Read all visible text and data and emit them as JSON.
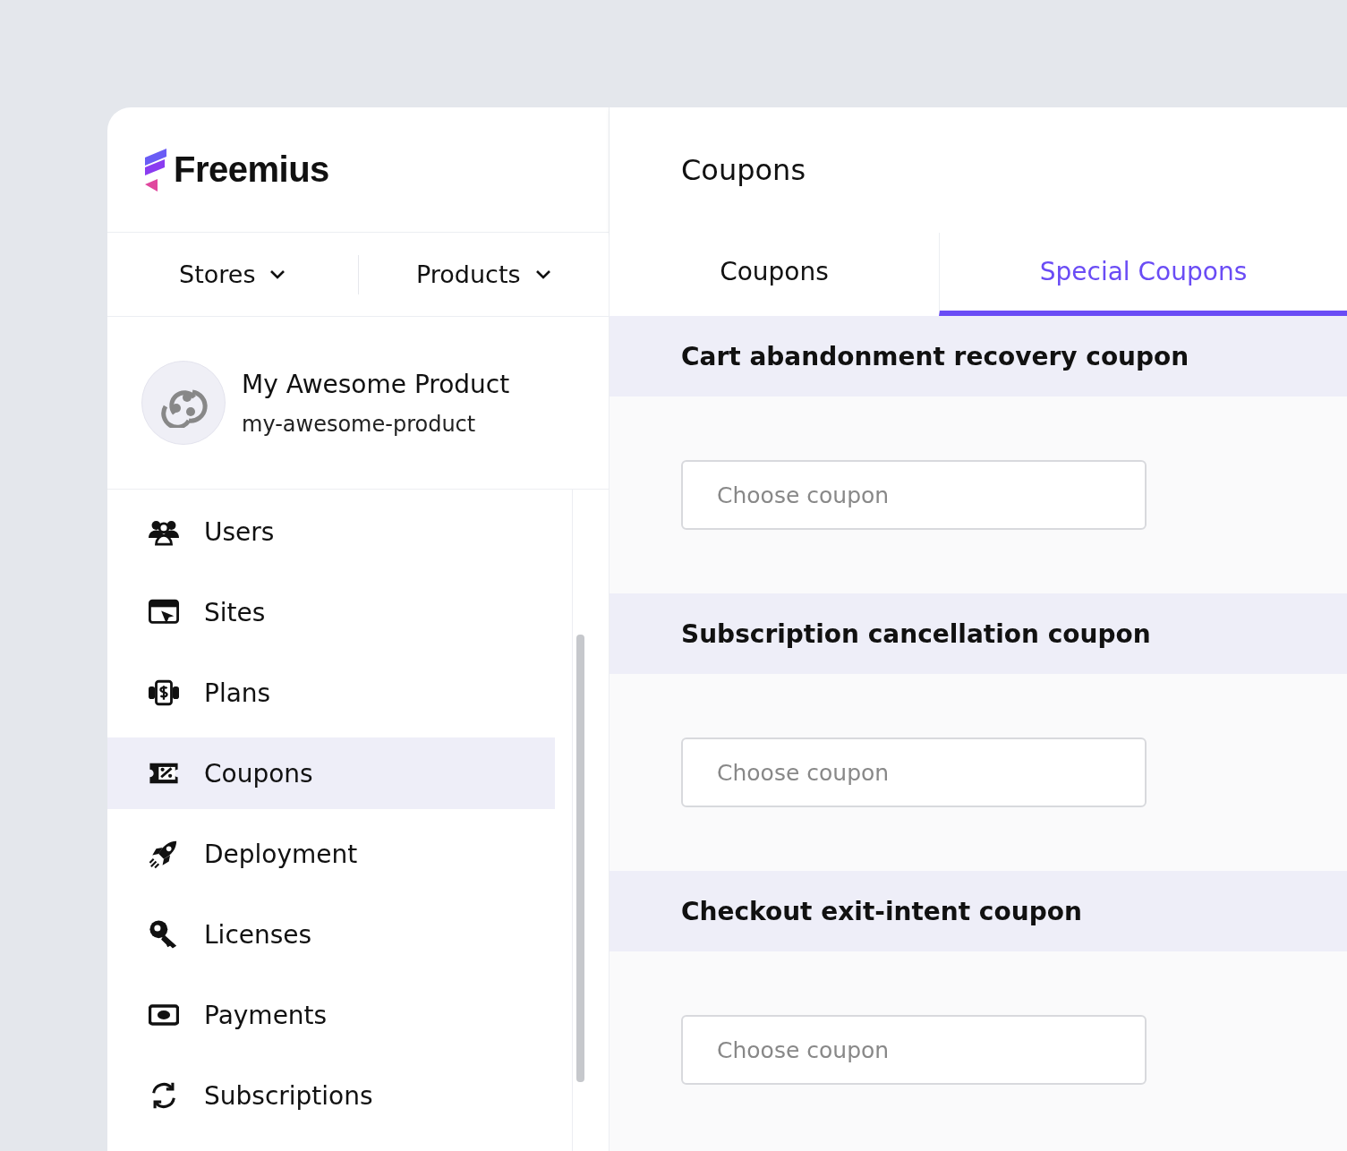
{
  "logo": {
    "text": "Freemius"
  },
  "switchers": [
    {
      "label": "Stores"
    },
    {
      "label": "Products"
    }
  ],
  "product": {
    "name": "My Awesome Product",
    "slug": "my-awesome-product"
  },
  "nav": [
    {
      "label": "Users",
      "selected": false
    },
    {
      "label": "Sites",
      "selected": false
    },
    {
      "label": "Plans",
      "selected": false
    },
    {
      "label": "Coupons",
      "selected": true
    },
    {
      "label": "Deployment",
      "selected": false
    },
    {
      "label": "Licenses",
      "selected": false
    },
    {
      "label": "Payments",
      "selected": false
    },
    {
      "label": "Subscriptions",
      "selected": false
    }
  ],
  "page_title": "Coupons",
  "tabs": [
    {
      "label": "Coupons",
      "selected": false
    },
    {
      "label": "Special Coupons",
      "selected": true
    }
  ],
  "sections": [
    {
      "title": "Cart abandonment recovery coupon",
      "placeholder": "Choose coupon"
    },
    {
      "title": "Subscription cancellation coupon",
      "placeholder": "Choose coupon"
    },
    {
      "title": "Checkout exit-intent coupon",
      "placeholder": "Choose coupon"
    }
  ]
}
